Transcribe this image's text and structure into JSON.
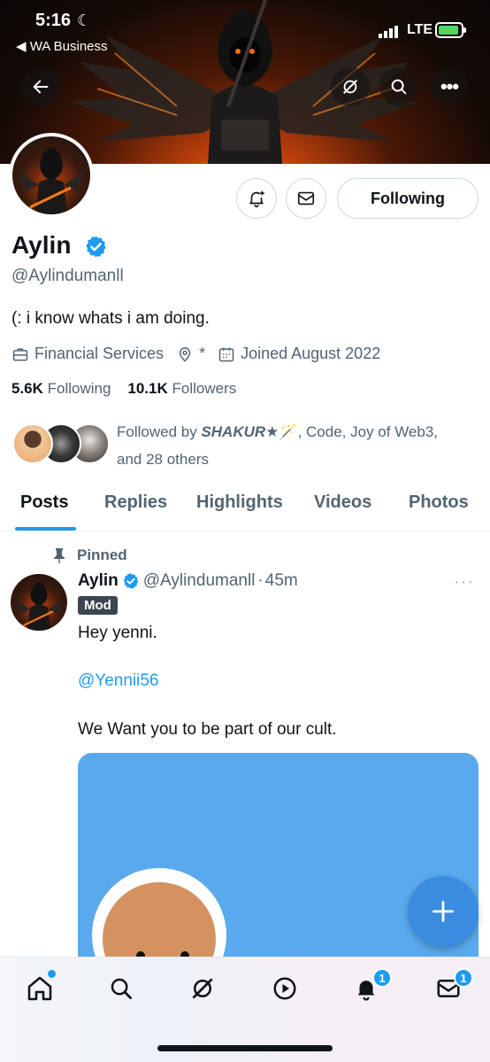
{
  "status_bar": {
    "time": "5:16",
    "back_app": "◀ WA Business",
    "network": "LTE"
  },
  "profile": {
    "name": "Aylin",
    "handle": "@Aylindumanll",
    "bio": "(: i know whats i am doing.",
    "category": "Financial Services",
    "location": "*",
    "joined": "Joined August 2022",
    "following_count": "5.6K",
    "following_label": "Following",
    "followers_count": "10.1K",
    "followers_label": "Followers",
    "followed_by_prefix": "Followed by ",
    "followed_by_name": "SHAKUR★",
    "followed_by_emoji": "🪄",
    "followed_by_rest": ", Code, Joy of Web3,",
    "followed_by_others": "and 28 others",
    "follow_button_label": "Following"
  },
  "tabs": [
    {
      "label": "Posts",
      "active": true
    },
    {
      "label": "Replies",
      "active": false
    },
    {
      "label": "Highlights",
      "active": false
    },
    {
      "label": "Videos",
      "active": false
    },
    {
      "label": "Photos",
      "active": false
    }
  ],
  "post": {
    "pinned_label": "Pinned",
    "author_name": "Aylin",
    "author_handle": "@Aylindumanll",
    "separator": "·",
    "time": "45m",
    "badge": "Mod",
    "line1": "Hey yenni.",
    "mention": "@Yennii56",
    "line2": "We Want you to be part of our cult.",
    "more": "···"
  },
  "nav": {
    "notifications_badge": "1",
    "messages_badge": "1"
  },
  "colors": {
    "accent": "#1d9bf0",
    "text_primary": "#0f1419",
    "text_secondary": "#536471"
  }
}
